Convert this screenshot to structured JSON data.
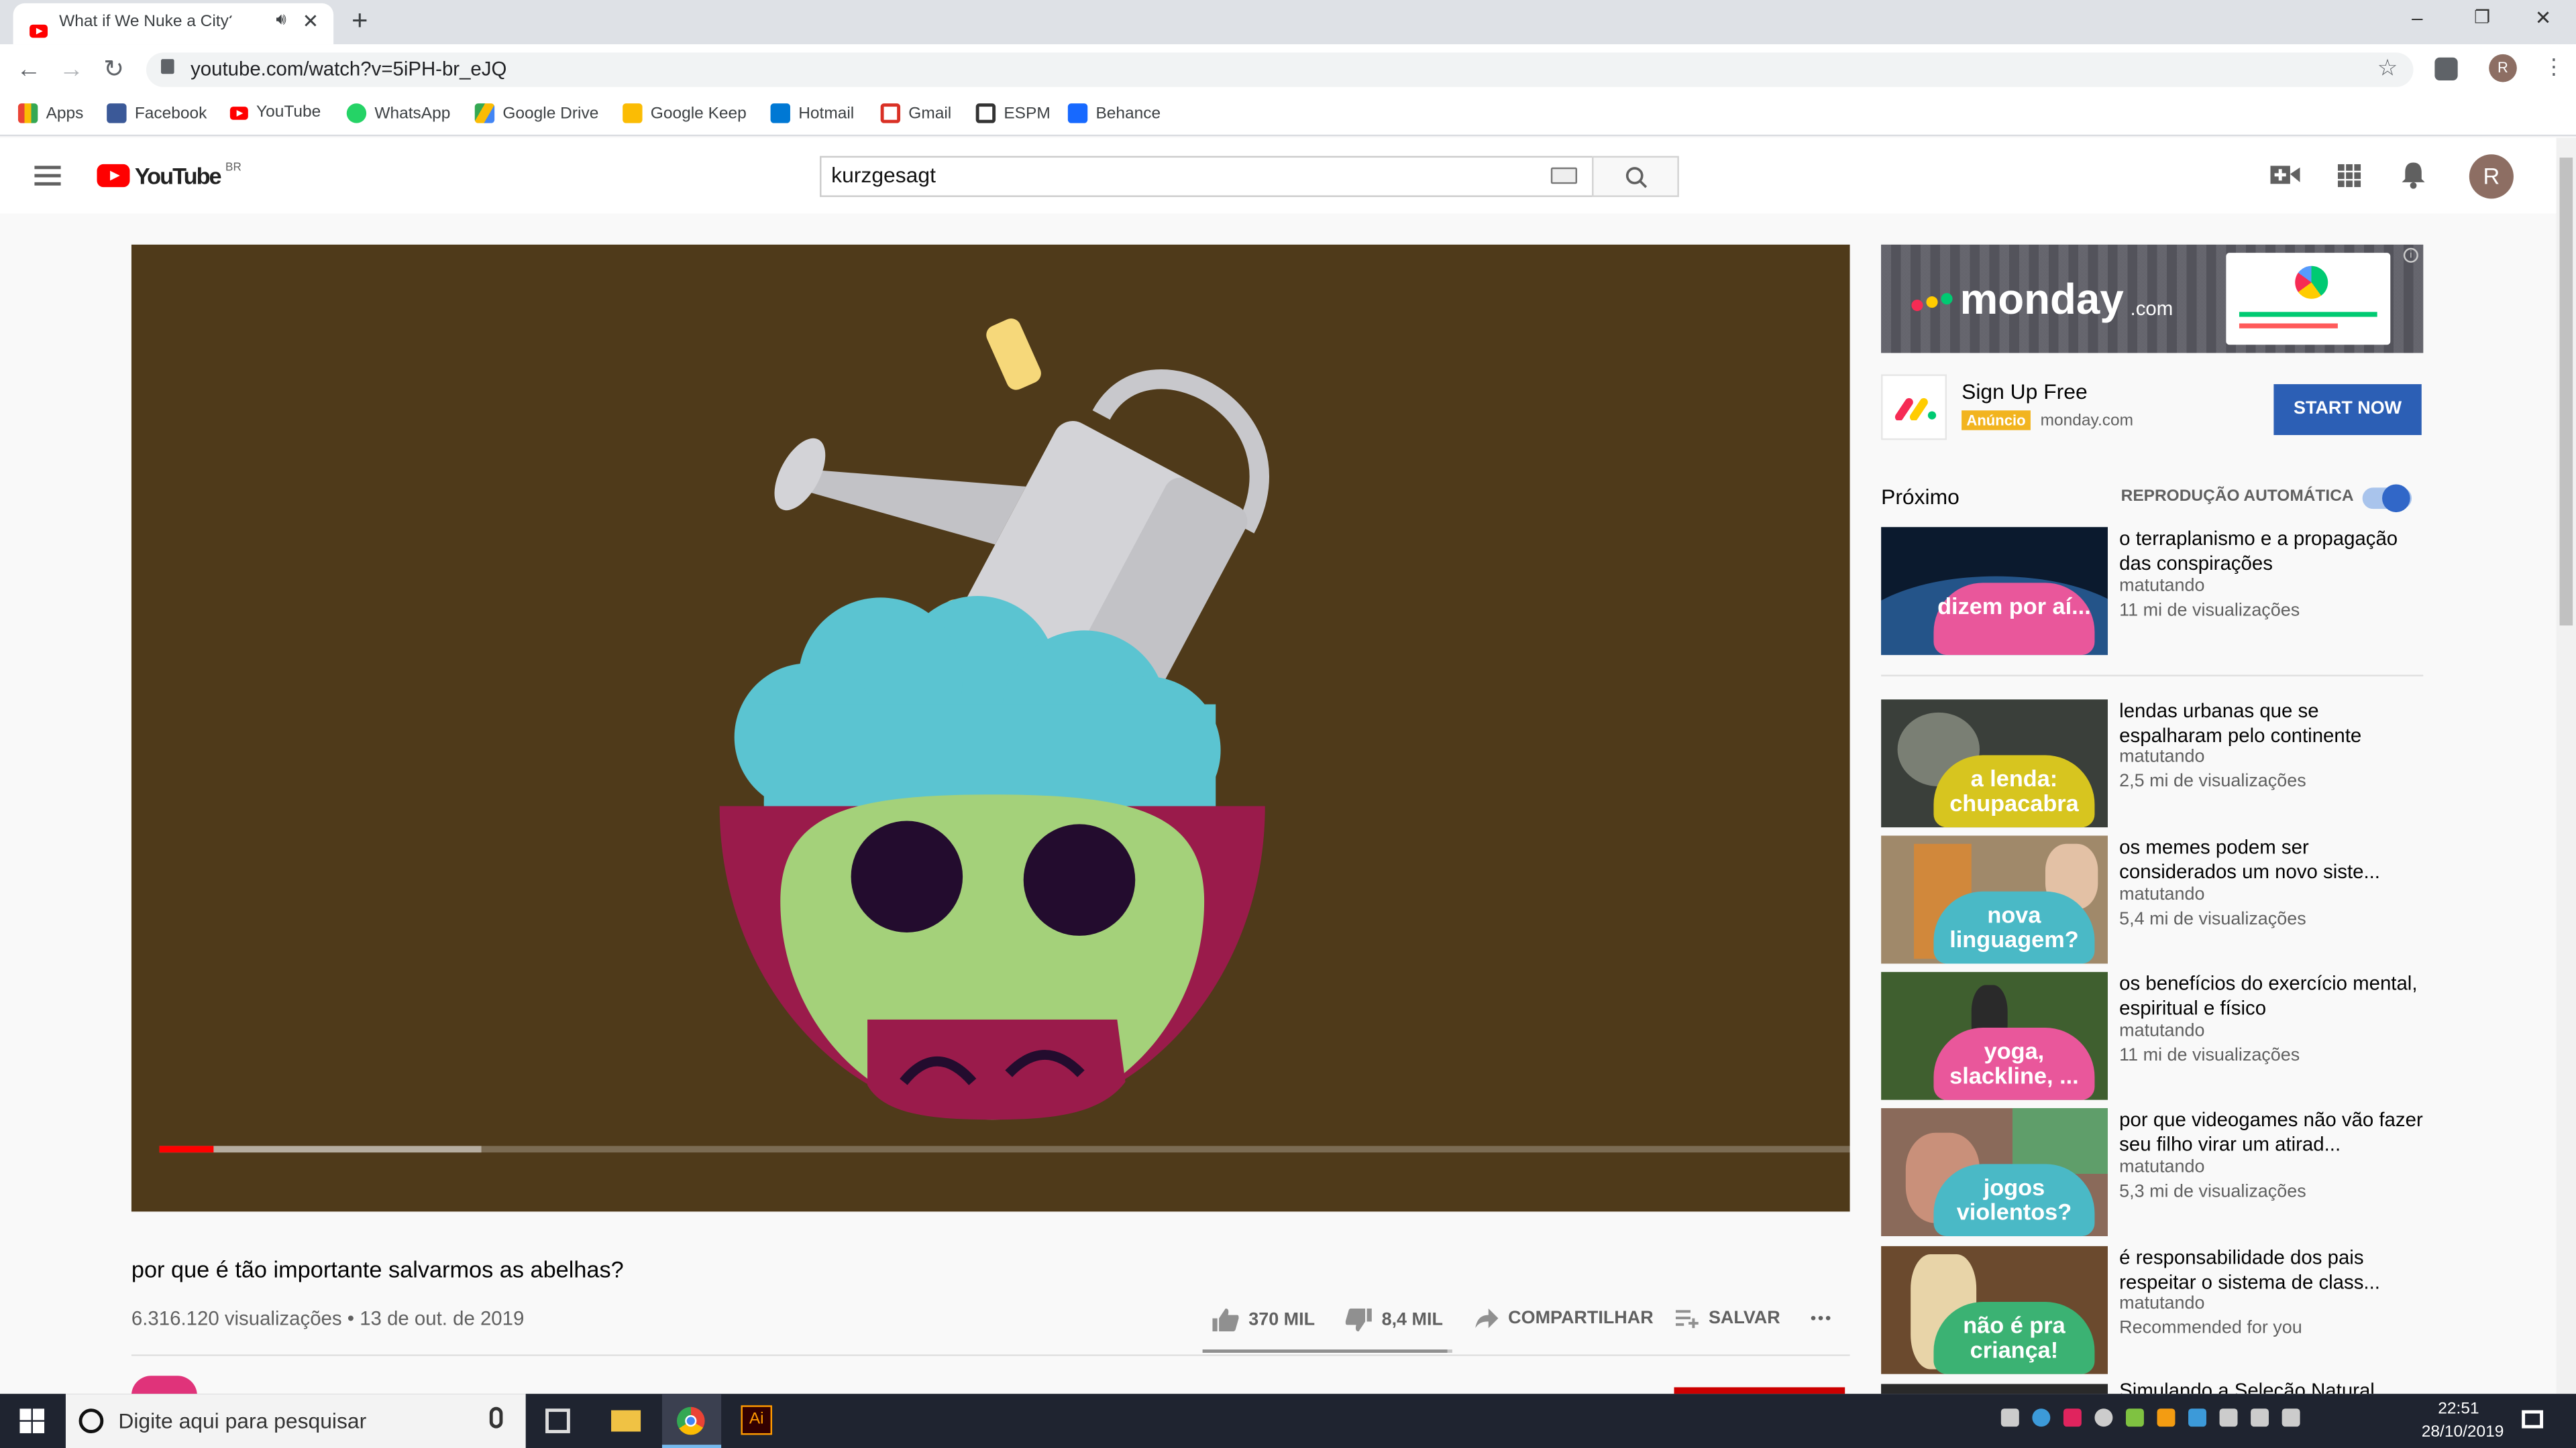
{
  "browser": {
    "tab_title": "What if We Nuke a City? - Yo",
    "new_tab": "+",
    "url": "youtube.com/watch?v=5iPH-br_eJQ",
    "profile_initial": "R",
    "window_minimize": "–",
    "window_restore": "❐",
    "window_close": "✕",
    "bookmarks": [
      {
        "label": "Apps",
        "color": "#4285f4"
      },
      {
        "label": "Facebook",
        "color": "#3b5998"
      },
      {
        "label": "YouTube",
        "color": "#ff0000"
      },
      {
        "label": "WhatsApp",
        "color": "#25d366"
      },
      {
        "label": "Google Drive",
        "color": "#fbbc04"
      },
      {
        "label": "Google Keep",
        "color": "#fbbc04"
      },
      {
        "label": "Hotmail",
        "color": "#0078d4"
      },
      {
        "label": "Gmail",
        "color": "#d93025"
      },
      {
        "label": "ESPM",
        "color": "#333333"
      },
      {
        "label": "Behance",
        "color": "#1769ff"
      }
    ]
  },
  "youtube": {
    "logo_text": "YouTube",
    "country": "BR",
    "search_value": "kurzgesagt",
    "avatar_initial": "R"
  },
  "video": {
    "progress_fraction": 0.032,
    "buffered_fraction": 0.19
  },
  "info": {
    "title": "por que é tão importante salvarmos as abelhas?",
    "meta": "6.316.120 visualizações • 13 de out. de 2019",
    "likes": "370 MIL",
    "dislikes": "8,4 MIL",
    "share": "COMPARTILHAR",
    "save": "SALVAR",
    "more": "•••",
    "like_ratio": 0.978
  },
  "ad": {
    "banner_text": "monday",
    "banner_suffix": ".com",
    "title": "Sign Up Free",
    "badge": "Anúncio",
    "domain": "monday.com",
    "cta": "START NOW",
    "info_icon": "i"
  },
  "sidebar": {
    "next_label": "Próximo",
    "autoplay_label": "REPRODUÇÃO AUTOMÁTICA",
    "autoplay_on": true,
    "items": [
      {
        "title": "o terraplanismo e a propagação das conspirações",
        "channel": "matutando",
        "views": "11 mi de visualizações",
        "bubble": "dizem por aí...",
        "bubble_color": "#e9579b",
        "bg": "#0b1a2e"
      },
      {
        "title": "lendas urbanas que se espalharam pelo continente",
        "channel": "matutando",
        "views": "2,5 mi de visualizações",
        "bubble": "a lenda: chupacabra",
        "bubble_color": "#d7c51f",
        "bg": "#3a3f3a"
      },
      {
        "title": "os memes podem ser considerados um novo siste...",
        "channel": "matutando",
        "views": "5,4 mi de visualizações",
        "bubble": "nova linguagem?",
        "bubble_color": "#4ab9c6",
        "bg": "#a0896a"
      },
      {
        "title": "os benefícios do exercício mental, espiritual e físico",
        "channel": "matutando",
        "views": "11 mi de visualizações",
        "bubble": "yoga, slackline, ...",
        "bubble_color": "#e9579b",
        "bg": "#3f5f2f"
      },
      {
        "title": "por que videogames não vão fazer seu filho virar um atirad...",
        "channel": "matutando",
        "views": "5,3 mi de visualizações",
        "bubble": "jogos violentos?",
        "bubble_color": "#4ab9c6",
        "bg": "#8a6a5a"
      },
      {
        "title": "é responsabilidade dos pais respeitar o sistema de class...",
        "channel": "matutando",
        "views": "Recommended for you",
        "bubble": "não é pra criança!",
        "bubble_color": "#3bb273",
        "bg": "#6b4a2e"
      }
    ],
    "partial_title": "Simulando a Seleção Natural"
  },
  "taskbar": {
    "search_placeholder": "Digite aqui para pesquisar",
    "time": "22:51",
    "date": "28/10/2019",
    "illustrator_label": "Ai"
  }
}
